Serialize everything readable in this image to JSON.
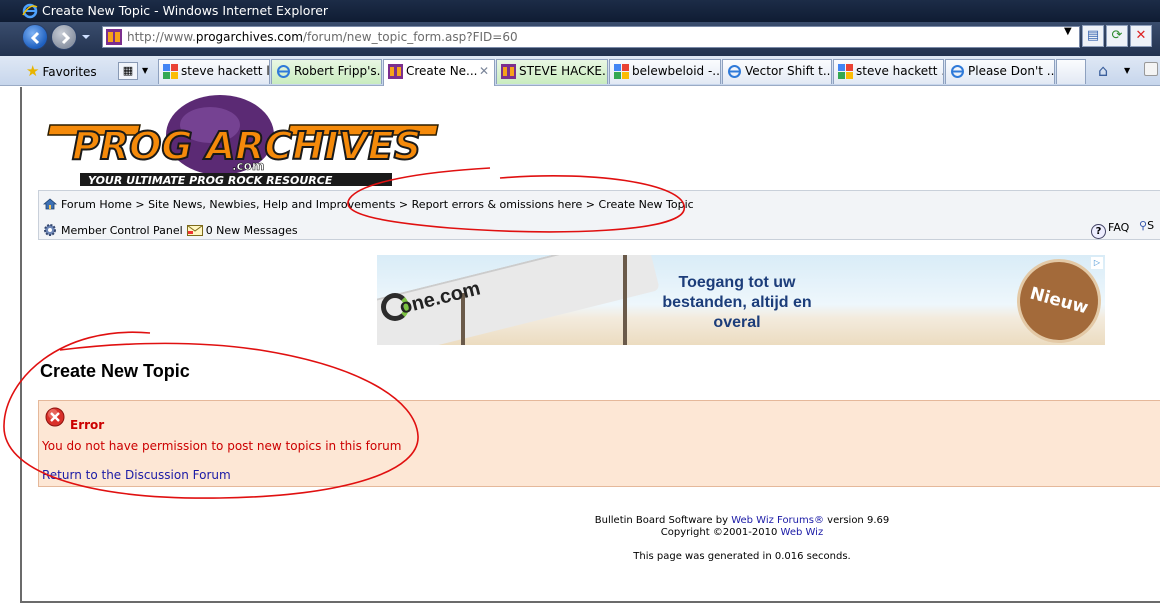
{
  "window": {
    "title": "Create New Topic - Windows Internet Explorer"
  },
  "address": {
    "url_prefix": "http://www.",
    "url_domain": "progarchives.com",
    "url_path": "/forum/new_topic_form.asp?FID=60"
  },
  "favorites": {
    "label": "Favorites"
  },
  "tabs": [
    {
      "label": "steve hackett l...",
      "icon": "google-icon",
      "active": false
    },
    {
      "label": "Robert Fripp's...",
      "icon": "ie-page-icon",
      "active": false
    },
    {
      "label": "Create Ne...",
      "icon": "progarchives-icon",
      "active": true
    },
    {
      "label": "STEVE HACKE...",
      "icon": "progarchives-icon",
      "active": false
    },
    {
      "label": "belewbeloid -...",
      "icon": "google-icon",
      "active": false
    },
    {
      "label": "Vector Shift t...",
      "icon": "ie-page-icon",
      "active": false
    },
    {
      "label": "steve hackett ...",
      "icon": "google-icon",
      "active": false
    },
    {
      "label": "Please Don't ...",
      "icon": "ie-page-icon",
      "active": false
    }
  ],
  "breadcrumb": {
    "items": [
      "Forum Home",
      "Site News, Newbies, Help and Improvements",
      "Report errors & omissions here",
      "Create New Topic"
    ],
    "separator": " > "
  },
  "member": {
    "control_panel": "Member Control Panel",
    "messages": "0 New Messages",
    "faq": "FAQ",
    "search_short": "S"
  },
  "ad": {
    "brand": "one.com",
    "slogan_1": "Toegang tot uw",
    "slogan_2": "bestanden, altijd en",
    "slogan_3": "overal",
    "badge": "Nieuw"
  },
  "page": {
    "title": "Create New Topic"
  },
  "error": {
    "title": "Error",
    "message": "You do not have permission to post new topics in this forum",
    "link": "Return to the Discussion Forum"
  },
  "footer": {
    "software_prefix": "Bulletin Board Software by ",
    "software_link": "Web Wiz Forums®",
    "software_suffix": " version 9.69",
    "copyright_prefix": "Copyright ©2001-2010 ",
    "copyright_link": "Web Wiz",
    "generated": "This page was generated in 0.016 seconds."
  },
  "colors": {
    "error_text": "#cc0000",
    "error_bg": "#fde7d5",
    "link": "#1a1aa6",
    "annotation": "#e01010"
  }
}
